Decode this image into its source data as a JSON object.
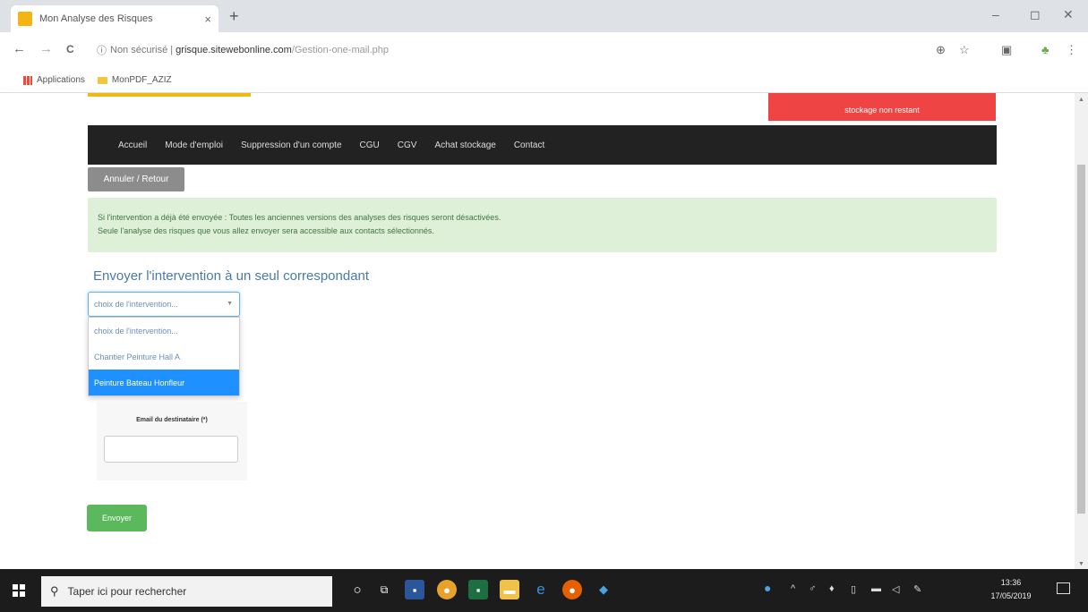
{
  "browser": {
    "tab_title": "Mon Analyse des Risques",
    "tab_close": "×",
    "new_tab": "+",
    "window_min": "–",
    "window_max": "◻",
    "window_close": "✕",
    "back": "←",
    "forward": "→",
    "reload": "C",
    "info_icon": "ⓘ",
    "security": "Non sécurisé |",
    "host": "grisque.sitewebonline.com",
    "path": "/Gestion-one-mail.php",
    "bookmarks": [
      {
        "label": "Applications",
        "icon": "apps-icon"
      },
      {
        "label": "MonPDF_AZIZ",
        "icon": "folder-icon"
      }
    ]
  },
  "header": {
    "alert_box": "stockage non restant"
  },
  "nav": {
    "items": [
      "Accueil",
      "Mode d'emploi",
      "Suppression d'un compte",
      "CGU",
      "CGV",
      "Achat stockage",
      "Contact"
    ]
  },
  "back_button": "Annuler / Retour",
  "alert": {
    "line1": "Si l'intervention a déjà été envoyée : Toutes les anciennes versions des analyses des risques seront désactivées.",
    "line2": "Seule l'analyse des risques que vous allez envoyer sera accessible aux contacts sélectionnés."
  },
  "section_title": "Envoyer l'intervention à un seul correspondant",
  "select": {
    "value": "choix de l'intervention...",
    "caret": "▼",
    "options": [
      {
        "label": "choix de l'intervention...",
        "selected": false
      },
      {
        "label": "Chantier Peinture Hall A",
        "selected": false
      },
      {
        "label": "Peinture Bateau Honfleur",
        "selected": true
      }
    ]
  },
  "email": {
    "label": "Email du destinataire (*)",
    "value": ""
  },
  "send_button": "Envoyer",
  "taskbar": {
    "search_placeholder": "Taper ici pour rechercher",
    "time": "13:36",
    "date": "17/05/2019"
  },
  "colors": {
    "navbar": "#222222",
    "alert_bg": "#dff0d8",
    "red_box": "#ef4444",
    "send": "#5cb85c",
    "selected_option": "#1e90ff"
  }
}
